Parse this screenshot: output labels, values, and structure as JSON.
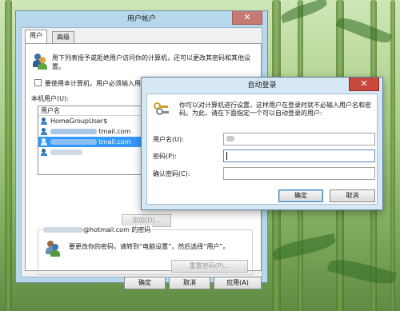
{
  "main_window": {
    "title": "用户帐户",
    "tabs": [
      {
        "label": "用户"
      },
      {
        "label": "高级"
      }
    ],
    "description": "用下列表授予或拒绝用户访问你的计算机，还可以更改其密码和其他设置。",
    "must_enter_checkbox": {
      "label": "要使用本计算机，用户必须输入用户名和密码(E)",
      "checked": false
    },
    "users_label": "本机用户(U):",
    "list_header": "用户名",
    "users": [
      {
        "name": "HomeGroupUser$",
        "selected": false
      },
      {
        "name": "tmail.com",
        "selected": false
      },
      {
        "name": "tmail.com",
        "selected": true
      },
      {
        "name": "",
        "selected": false
      }
    ],
    "add_button": "添加(D)...",
    "password_group_title": "@hotmail.com 的密码",
    "password_info": "要更改你的密码，请转到“电脑设置”，然后选择“用户”。",
    "reset_button": "重置密码(P)...",
    "ok": "确定",
    "cancel": "取消",
    "apply": "应用(A)"
  },
  "auto_logon_dialog": {
    "title": "自动登录",
    "close_glyph": "✕",
    "description": "你可以对计算机进行设置，这样用户在登录时就不必输入用户名和密码。为此，请在下面指定一个可以自动登录的用户:",
    "username_label": "用户名(U):",
    "username_value": "",
    "password_label": "密码(P):",
    "password_value": "",
    "confirm_label": "确认密码(C):",
    "confirm_value": "",
    "ok": "确定",
    "cancel": "取消"
  },
  "colors": {
    "close_button": "#c9483e",
    "selection": "#3399ff",
    "title_tint": "#b7d8ec"
  }
}
